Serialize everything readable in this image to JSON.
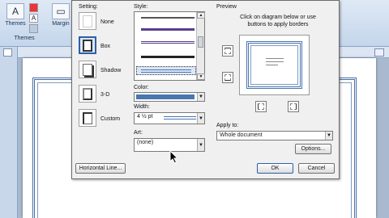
{
  "ribbon": {
    "themes_label": "Themes",
    "themes_group": "Themes",
    "margins_label": "Margin",
    "colors": {
      "ribbon_top": "#dfe9f5",
      "ribbon_bottom": "#c4d6ec"
    }
  },
  "dialog": {
    "setting": {
      "title": "Setting:",
      "items": [
        {
          "label": "None",
          "icon": "setting-none-icon"
        },
        {
          "label": "Box",
          "icon": "setting-box-icon"
        },
        {
          "label": "Shadow",
          "icon": "setting-shadow-icon"
        },
        {
          "label": "3-D",
          "icon": "setting-3d-icon"
        },
        {
          "label": "Custom",
          "icon": "setting-custom-icon"
        }
      ]
    },
    "style": {
      "title": "Style:",
      "lines": [
        {
          "color": "#555555"
        },
        {
          "color": "#5a3d8a"
        },
        {
          "color": "#5a3d8a"
        },
        {
          "color": "#222222"
        },
        {
          "color": "#4a76b0",
          "selected": true
        }
      ]
    },
    "color": {
      "label": "Color:",
      "value_hex": "#4a76b0"
    },
    "width": {
      "label": "Width:",
      "value": "4 ½ pt"
    },
    "art": {
      "label": "Art:",
      "value": "(none)"
    },
    "preview": {
      "title": "Preview",
      "hint": "Click on diagram below or use buttons to apply borders"
    },
    "apply_to": {
      "label": "Apply to:",
      "value": "Whole document"
    },
    "buttons": {
      "options": "Options...",
      "horizontal_line": "Horizontal Line...",
      "ok": "OK",
      "cancel": "Cancel"
    }
  }
}
